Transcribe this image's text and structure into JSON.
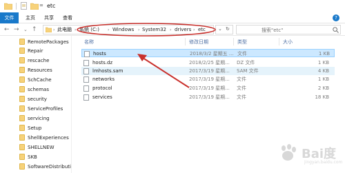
{
  "window": {
    "title": "etc",
    "title_dropdown": "="
  },
  "ribbon": {
    "tabs": [
      "文件",
      "主页",
      "共享",
      "查看"
    ],
    "help": "?"
  },
  "nav": {
    "back": "←",
    "forward": "→",
    "recent": "⌄",
    "up": "↑"
  },
  "address": {
    "crumbs": [
      "此电脑",
      "系统 (C:)",
      "Windows",
      "System32",
      "drivers",
      "etc"
    ],
    "sep": "›",
    "dropdown": "⌄",
    "refresh": "↻"
  },
  "search": {
    "placeholder": "搜索\"etc\""
  },
  "columns": {
    "name": "名称",
    "date": "修改日期",
    "type": "类型",
    "size": "大小"
  },
  "files": [
    {
      "name": "hosts",
      "date": "2018/3/2 星期五 ...",
      "type": "文件",
      "size": "1 KB",
      "state": "selected"
    },
    {
      "name": "hosts.dz",
      "date": "2018/2/25 星期...",
      "type": "DZ 文件",
      "size": "1 KB",
      "state": "normal"
    },
    {
      "name": "lmhosts.sam",
      "date": "2017/3/19 星期...",
      "type": "SAM 文件",
      "size": "4 KB",
      "state": "hover"
    },
    {
      "name": "networks",
      "date": "2017/3/19 星期...",
      "type": "文件",
      "size": "1 KB",
      "state": "normal"
    },
    {
      "name": "protocol",
      "date": "2017/3/19 星期...",
      "type": "文件",
      "size": "2 KB",
      "state": "normal"
    },
    {
      "name": "services",
      "date": "2017/3/19 星期...",
      "type": "文件",
      "size": "18 KB",
      "state": "normal"
    }
  ],
  "sidebar": {
    "items": [
      "RemotePackages",
      "Repair",
      "rescache",
      "Resources",
      "SchCache",
      "schemas",
      "security",
      "ServiceProfiles",
      "servicing",
      "Setup",
      "ShellExperiences",
      "SHELLNEW",
      "SKB",
      "SoftwareDistributi"
    ]
  },
  "watermark": {
    "text": "Bai度",
    "sub": "jingyan.baidu.com"
  },
  "colors": {
    "accent": "#1979ca",
    "selection": "#cce8ff",
    "annotation": "#c9302c"
  }
}
